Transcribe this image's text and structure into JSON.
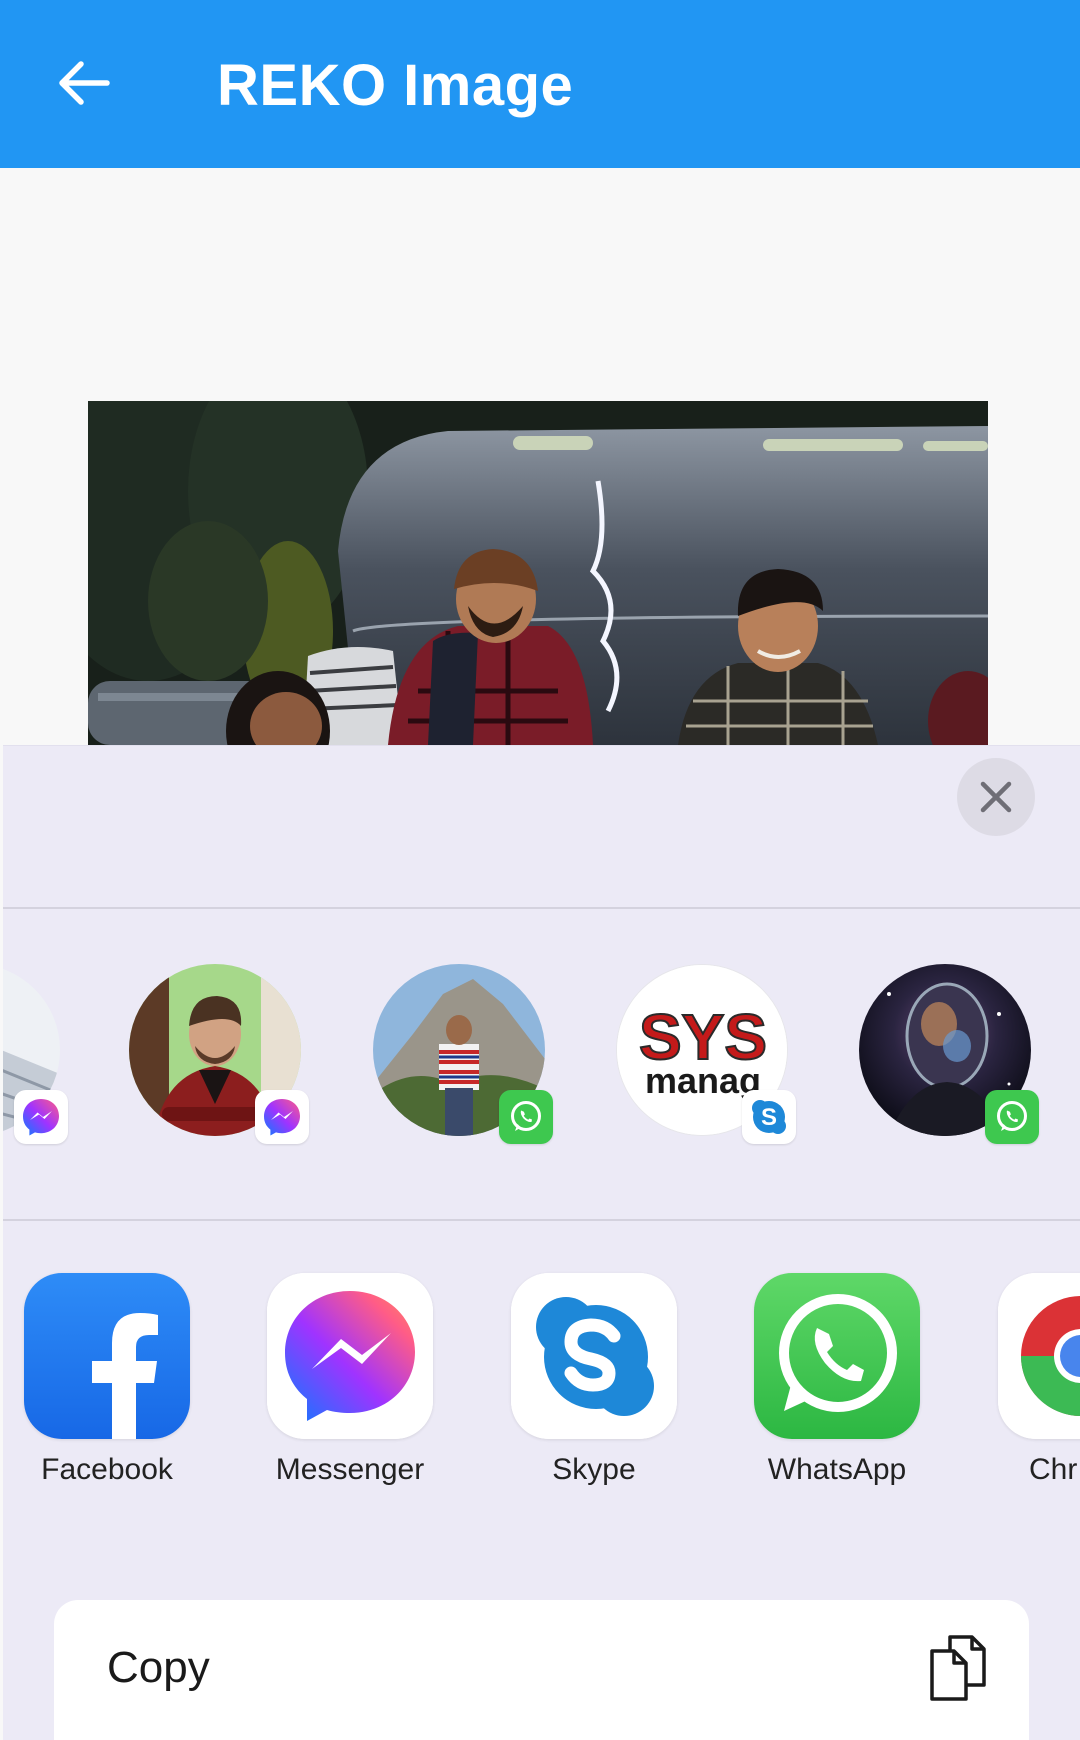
{
  "app_bar": {
    "title": "REKO Image",
    "background": "#2196f3",
    "back_icon": "arrow-left-icon"
  },
  "image": {
    "subject": "photo of three people sitting by an aluminum camper trailer at dusk"
  },
  "share_sheet": {
    "close_icon": "close-icon",
    "people": [
      {
        "avatar": "building-photo",
        "badge": "messenger-icon"
      },
      {
        "avatar": "man-red-jacket-photo",
        "badge": "messenger-icon"
      },
      {
        "avatar": "man-striped-shirt-photo",
        "badge": "whatsapp-icon"
      },
      {
        "avatar": "sys-logo",
        "badge": "skype-icon"
      },
      {
        "avatar": "cosmic-head-photo",
        "badge": "whatsapp-icon"
      }
    ],
    "apps": [
      {
        "label": "Facebook",
        "icon": "facebook-icon"
      },
      {
        "label": "Messenger",
        "icon": "messenger-icon"
      },
      {
        "label": "Skype",
        "icon": "skype-icon"
      },
      {
        "label": "WhatsApp",
        "icon": "whatsapp-icon"
      },
      {
        "label": "Chr",
        "icon": "chrome-icon"
      }
    ],
    "actions": [
      {
        "label": "Copy",
        "icon": "copy-icon"
      }
    ]
  },
  "colors": {
    "sheet_background": "#eceaf6",
    "facebook": "#1877f2",
    "whatsapp": "#3ec84f",
    "skype": "#1e88d8"
  }
}
